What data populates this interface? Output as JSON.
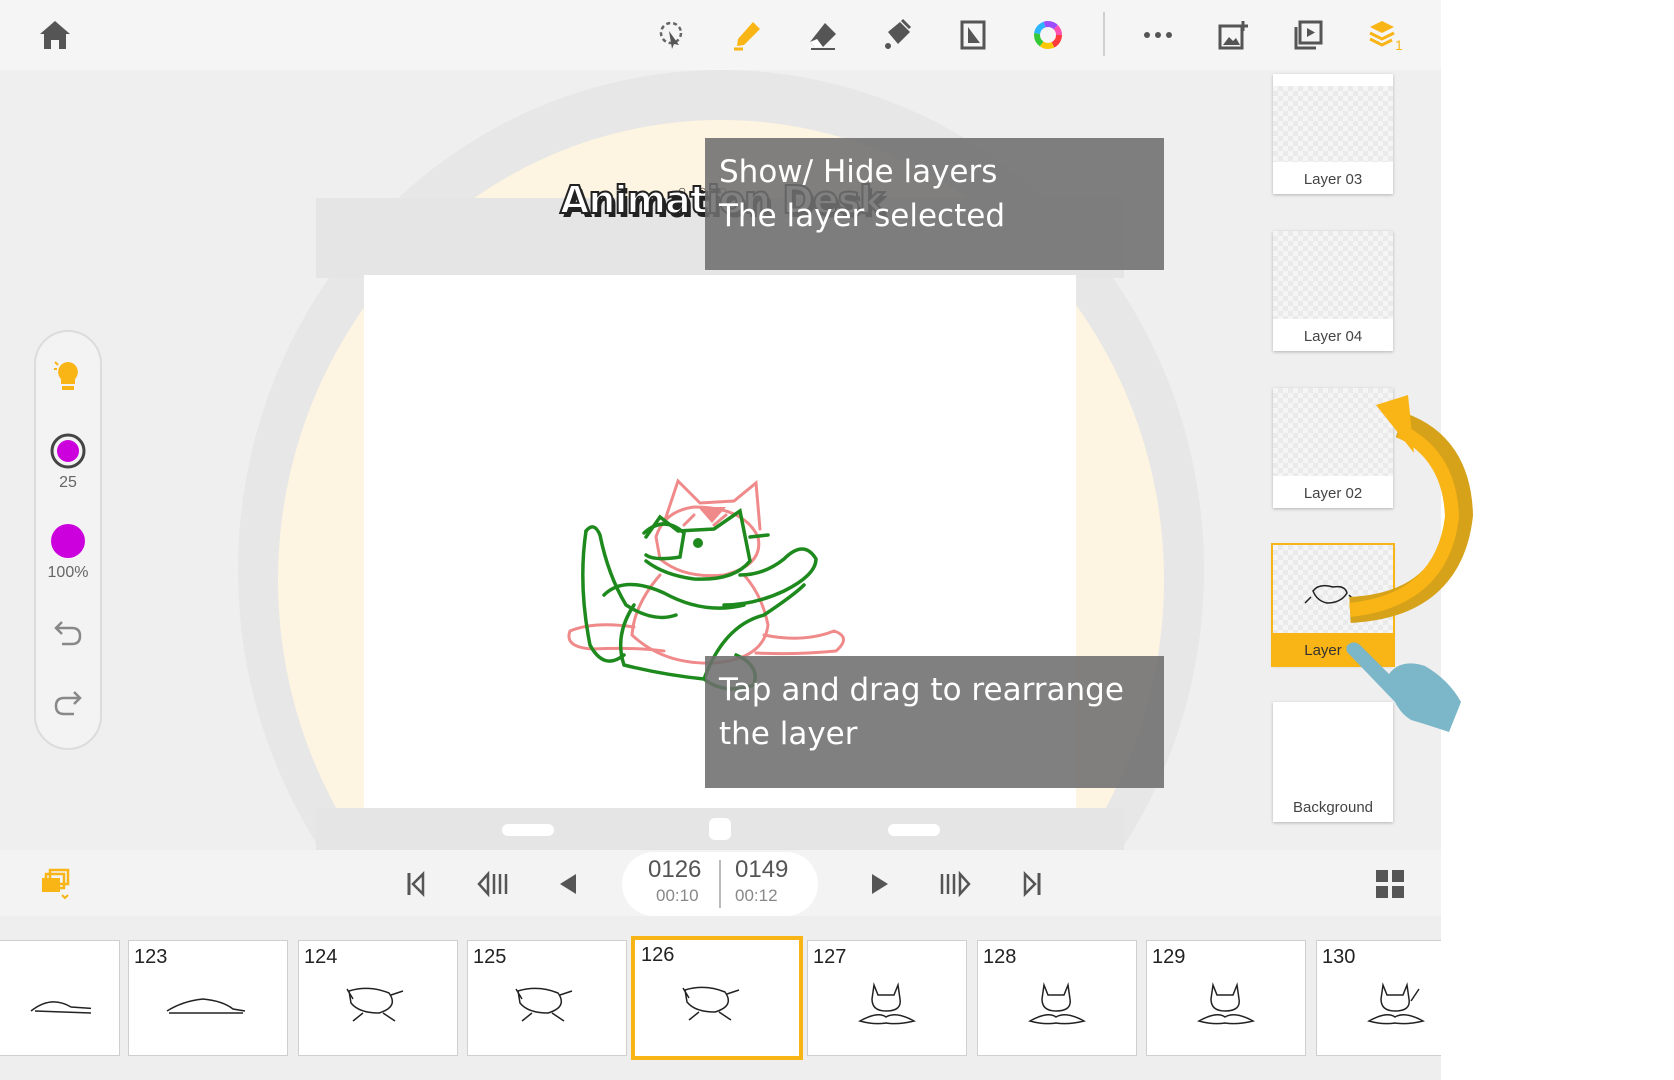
{
  "app": {
    "logo": "Animation Desk"
  },
  "toolbar": {
    "icons": [
      "home-icon",
      "lasso-icon",
      "pen-icon",
      "eraser-icon",
      "fill-bucket-icon",
      "ruler-icon",
      "color-wheel-icon",
      "more-icon",
      "add-image-icon",
      "play-preview-icon",
      "layers-icon"
    ],
    "layers_count": "1",
    "accent": "#f9b415"
  },
  "tooltips": {
    "top": [
      "Show/ Hide layers",
      "The layer selected"
    ],
    "bottom": [
      "Tap and drag to rearrange",
      "the layer"
    ]
  },
  "tools": {
    "brush_size": "25",
    "opacity": "100%",
    "brush_color": "#cc00dd"
  },
  "layers": [
    {
      "name": "Layer 03",
      "selected": false
    },
    {
      "name": "Layer 04",
      "selected": false
    },
    {
      "name": "Layer 02",
      "selected": false
    },
    {
      "name": "Layer",
      "selected": true
    },
    {
      "name": "Background",
      "selected": false
    }
  ],
  "playback": {
    "current_frame": "0126",
    "current_time": "00:10",
    "total_frames": "0149",
    "total_time": "00:12"
  },
  "filmstrip": {
    "frames": [
      "",
      "123",
      "124",
      "125",
      "126",
      "127",
      "128",
      "129",
      "130"
    ],
    "current": "126"
  }
}
